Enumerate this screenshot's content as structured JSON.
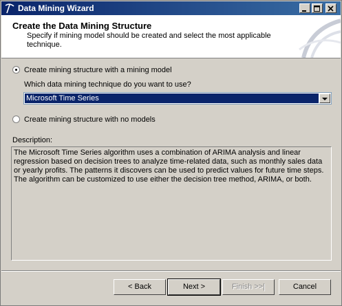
{
  "window": {
    "title": "Data Mining Wizard"
  },
  "header": {
    "title": "Create the Data Mining Structure",
    "subtitle": "Specify if mining model should be created and select the most applicable technique."
  },
  "options": {
    "with_model_label": "Create mining structure with a mining  model",
    "technique_question": "Which data mining technique do you want to use?",
    "technique_selected": "Microsoft Time Series",
    "no_models_label": "Create mining structure with no models"
  },
  "description": {
    "label": "Description:",
    "text": "The Microsoft Time Series algorithm uses a combination of ARIMA analysis and linear regression based on decision trees to analyze time-related data, such as monthly sales data or yearly profits. The patterns it discovers can be used to predict values for future time steps. The algorithm can be customized to use either the decision tree method, ARIMA, or both."
  },
  "buttons": {
    "back": "< Back",
    "next": "Next >",
    "finish": "Finish >>|",
    "cancel": "Cancel"
  }
}
